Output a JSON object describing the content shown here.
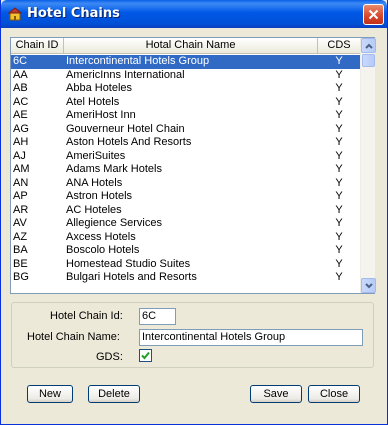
{
  "window": {
    "title": "Hotel Chains",
    "icon": "hotel-chains-app-icon",
    "close_icon": "close-icon"
  },
  "table": {
    "columns": [
      "Chain ID",
      "Hotal Chain Name",
      "CDS"
    ],
    "selected_index": 0,
    "rows": [
      {
        "id": "6C",
        "name": "Intercontinental Hotels Group",
        "cds": "Y"
      },
      {
        "id": "AA",
        "name": "AmericInns International",
        "cds": "Y"
      },
      {
        "id": "AB",
        "name": "Abba Hoteles",
        "cds": "Y"
      },
      {
        "id": "AC",
        "name": "Atel Hotels",
        "cds": "Y"
      },
      {
        "id": "AE",
        "name": "AmeriHost Inn",
        "cds": "Y"
      },
      {
        "id": "AG",
        "name": "Gouverneur Hotel Chain",
        "cds": "Y"
      },
      {
        "id": "AH",
        "name": "Aston Hotels And Resorts",
        "cds": "Y"
      },
      {
        "id": "AJ",
        "name": "AmeriSuites",
        "cds": "Y"
      },
      {
        "id": "AM",
        "name": "Adams Mark Hotels",
        "cds": "Y"
      },
      {
        "id": "AN",
        "name": "ANA Hotels",
        "cds": "Y"
      },
      {
        "id": "AP",
        "name": "Astron Hotels",
        "cds": "Y"
      },
      {
        "id": "AR",
        "name": "AC Hoteles",
        "cds": "Y"
      },
      {
        "id": "AV",
        "name": "Allegience Services",
        "cds": "Y"
      },
      {
        "id": "AZ",
        "name": "Axcess Hotels",
        "cds": "Y"
      },
      {
        "id": "BA",
        "name": "Boscolo Hotels",
        "cds": "Y"
      },
      {
        "id": "BE",
        "name": "Homestead Studio Suites",
        "cds": "Y"
      },
      {
        "id": "BG",
        "name": "Bulgari Hotels and Resorts",
        "cds": "Y"
      }
    ]
  },
  "form": {
    "chain_id_label": "Hotel Chain Id:",
    "chain_id_value": "6C",
    "chain_name_label": "Hotel Chain Name:",
    "chain_name_value": "Intercontinental Hotels Group",
    "gds_label": "GDS:",
    "gds_checked": true
  },
  "buttons": {
    "new": "New",
    "delete": "Delete",
    "save": "Save",
    "close": "Close"
  },
  "colors": {
    "selection": "#316ac5",
    "titlebar": "#0058e6",
    "close_button": "#d6462a"
  }
}
